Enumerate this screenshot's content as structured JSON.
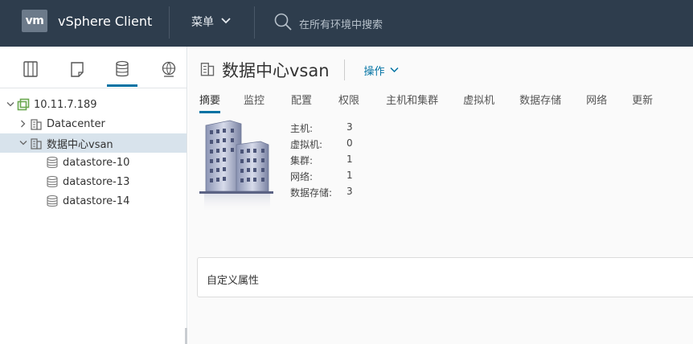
{
  "header": {
    "logo": "vm",
    "app_title": "vSphere Client",
    "menu_label": "菜单",
    "search_placeholder": "在所有环境中搜索"
  },
  "nav_icons": [
    "hosts-clusters-icon",
    "vms-templates-icon",
    "storage-icon",
    "networking-icon"
  ],
  "tree": {
    "root": "10.11.7.189",
    "items": [
      {
        "label": "Datacenter"
      },
      {
        "label": "数据中心vsan"
      },
      {
        "label": "datastore-10"
      },
      {
        "label": "datastore-13"
      },
      {
        "label": "datastore-14"
      }
    ]
  },
  "main": {
    "title": "数据中心vsan",
    "actions_label": "操作",
    "tabs": [
      "摘要",
      "监控",
      "配置",
      "权限",
      "主机和集群",
      "虚拟机",
      "数据存储",
      "网络",
      "更新"
    ],
    "stats": [
      {
        "label": "主机:",
        "value": "3"
      },
      {
        "label": "虚拟机:",
        "value": "0"
      },
      {
        "label": "集群:",
        "value": "1"
      },
      {
        "label": "网络:",
        "value": "1"
      },
      {
        "label": "数据存储:",
        "value": "3"
      }
    ],
    "card_title": "自定义属性"
  },
  "colors": {
    "header_bg": "#2e3d4d",
    "accent": "#0072a3",
    "selection": "#d8e3ec"
  }
}
